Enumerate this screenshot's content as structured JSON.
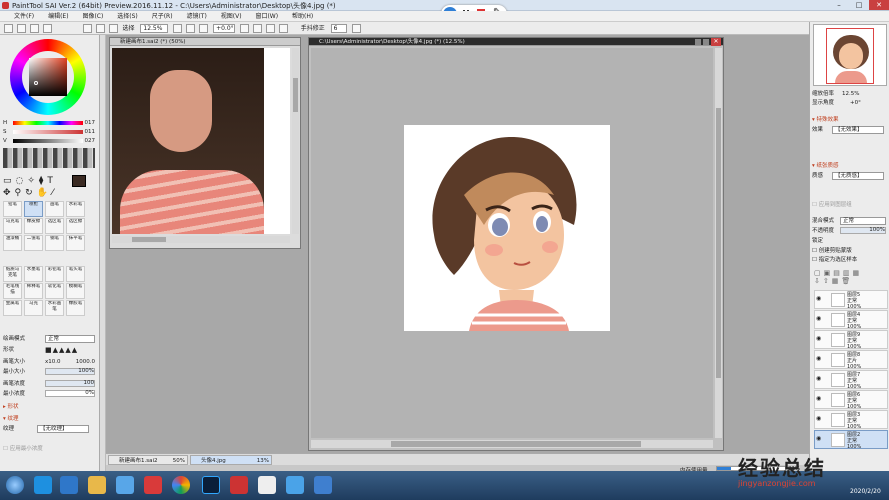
{
  "window": {
    "title": "PaintTool SAI Ver.2 (64bit) Preview.2016.11.12 - C:\\Users\\Administrator\\Desktop\\头像4.jpg (*)",
    "controls": [
      "–",
      "□",
      "✕"
    ]
  },
  "menu": [
    "文件(F)",
    "编辑(E)",
    "图像(C)",
    "选择(S)",
    "尺子(R)",
    "滤镜(T)",
    "视图(V)",
    "窗口(W)",
    "帮助(H)"
  ],
  "toolbar": {
    "select_label": "选择",
    "zoom": "12.5%",
    "angle": "+0.0°",
    "stabilizer_label": "手抖修正",
    "stabilizer_value": "6"
  },
  "capture_widget": {
    "time": "12:37"
  },
  "color": {
    "h_label": "H",
    "h_value": "017",
    "s_label": "S",
    "s_value": "011",
    "v_label": "V",
    "v_value": "027"
  },
  "tools": {
    "row1": [
      "铅笔",
      "喷枪",
      "画笔",
      "水彩笔"
    ],
    "row2": [
      "马克笔",
      "橡皮擦",
      "选区笔",
      "选区擦"
    ],
    "row3": [
      "油漆桶",
      "二值笔",
      "钢笔",
      "抹平笔"
    ],
    "row4": [
      "纸质马克笔",
      "水墨笔",
      "彩铅笔",
      "笔头笔"
    ],
    "row5": [
      "毛笔线描",
      "稀释笔",
      "软化笔",
      "模糊笔"
    ],
    "row6": [
      "金属笔",
      "马克",
      "水彩画笔",
      "橡胶笔"
    ]
  },
  "brush_settings": {
    "blend_mode_label": "绘画模式",
    "blend_mode_value": "正常",
    "shape_label": "形状",
    "size_label": "画笔大小",
    "size_mult": "x10.0",
    "size_value": "1000.0",
    "min_size_label": "最小大小",
    "min_size_value": "100%",
    "density_label": "画笔浓度",
    "density_value": "100",
    "min_density_label": "最小浓度",
    "min_density_value": "0%",
    "shape_section": "形状",
    "texture_section": "纹理",
    "texture_label": "纹理",
    "texture_value": "【无纹理】",
    "apply_label": "应用最小浓度"
  },
  "windows": {
    "photo": {
      "title": "新建画布1.sai2 (*) (50%)"
    },
    "main": {
      "title": "C:\\Users\\Administrator\\Desktop\\头像4.jpg (*) (12.5%)"
    }
  },
  "navigator": {
    "zoom_label": "缩放倍率",
    "zoom_value": "12.5%",
    "angle_label": "显示角度",
    "angle_value": "+0°"
  },
  "effects": {
    "section": "特殊效果",
    "effect_label": "效果",
    "effect_value": "【无效果】",
    "mat_section": "纸张质感",
    "mat_label": "质感",
    "mat_value": "【无质感】",
    "mat_apply": "应用到图层组"
  },
  "layer_props": {
    "blend_label": "混合模式",
    "blend_value": "正常",
    "opacity_label": "不透明度",
    "opacity_value": "100%",
    "lock_label": "锁定",
    "clip_label": "创建剪贴蒙版",
    "ref_label": "指定为选区样本"
  },
  "layers": [
    {
      "name": "图层5",
      "mode": "正常",
      "opacity": "100%",
      "visible": true
    },
    {
      "name": "图层4",
      "mode": "正常",
      "opacity": "100%",
      "visible": true
    },
    {
      "name": "图层9",
      "mode": "正常",
      "opacity": "100%",
      "visible": true
    },
    {
      "name": "图层8",
      "mode": "正片",
      "opacity": "100%",
      "visible": true
    },
    {
      "name": "图层7",
      "mode": "正常",
      "opacity": "100%",
      "visible": true
    },
    {
      "name": "图层6",
      "mode": "正常",
      "opacity": "100%",
      "visible": true
    },
    {
      "name": "图层3",
      "mode": "正常",
      "opacity": "100%",
      "visible": true
    },
    {
      "name": "图层2",
      "mode": "正常",
      "opacity": "100%",
      "visible": true
    }
  ],
  "doc_tabs": [
    {
      "name": "新建画布1.sai2",
      "zoom": "50%"
    },
    {
      "name": "头像4.jpg",
      "zoom": "13%"
    }
  ],
  "memory": {
    "label": "内存使用量",
    "value": "21%"
  },
  "taskbar": {
    "date": "2020/2/20"
  },
  "watermark": {
    "line1": "经验总结",
    "line2": "jingyanzongjie.com"
  },
  "colors": {
    "accent": "#2f7fd6",
    "taskbar": "#284a70",
    "layer_sel": "#cfe0f5"
  }
}
